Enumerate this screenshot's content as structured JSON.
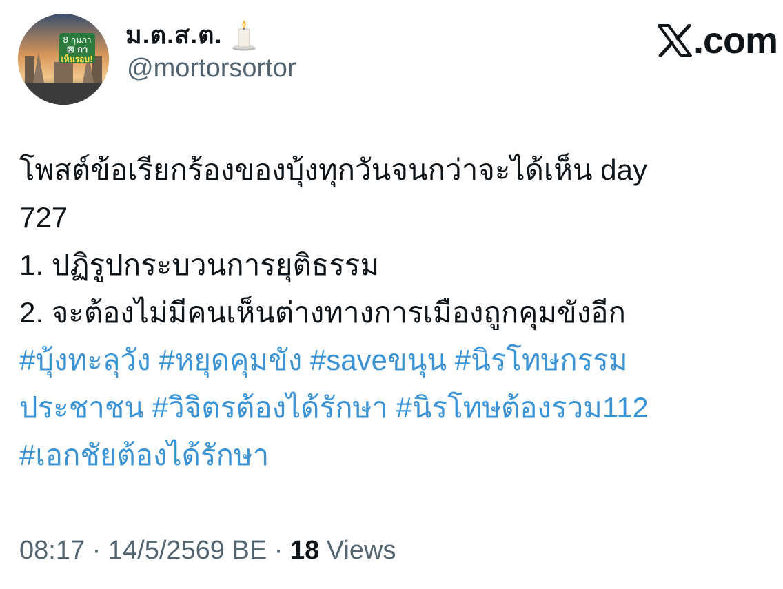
{
  "author": {
    "display_name": "ม.ต.ส.ต.",
    "handle": "@mortorsortor",
    "avatar_text": "8 กุมภา ⊠ กา เห็นรอบ!",
    "badge_icon": "candle-icon"
  },
  "brand": {
    "logo_icon": "x-logo-icon",
    "label": ".com"
  },
  "tweet": {
    "lines": [
      "โพสต์ข้อเรียกร้องของบุ้งทุกวันจนกว่าจะได้เห็น day",
      "727",
      "1. ปฏิรูปกระบวนการยุติธรรม",
      "2. จะต้องไม่มีคนเห็นต่างทางการเมืองถูกคุมขังอีก"
    ],
    "hashtag_lines": [
      "#บุ้งทะลุวัง #หยุดคุมขัง #saveขนุน #นิรโทษกรรม",
      "ประชาชน #วิจิตรต้องได้รักษา #นิรโทษต้องรวม112",
      "#เอกชัยต้องได้รักษา"
    ]
  },
  "meta": {
    "time": "08:17",
    "separator": " · ",
    "date": "14/5/2569 BE",
    "views_count": "18",
    "views_label": " Views"
  },
  "colors": {
    "text": "#0f1419",
    "secondary": "#536471",
    "hashtag": "#3c93d4"
  }
}
